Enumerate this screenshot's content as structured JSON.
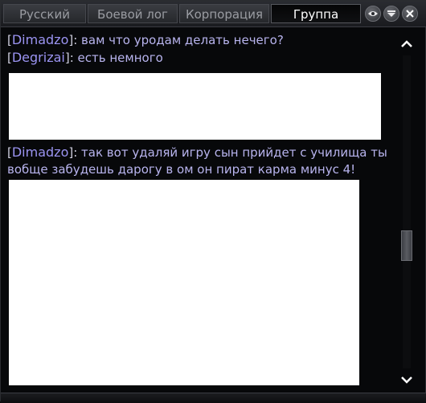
{
  "tabs": [
    {
      "label": "Русский",
      "active": false
    },
    {
      "label": "Боевой лог",
      "active": false
    },
    {
      "label": "Корпорация",
      "active": false
    },
    {
      "label": "Группа",
      "active": true
    }
  ],
  "controls": {
    "visibility_icon": "eye-icon",
    "filter_icon": "filter-icon",
    "close_icon": "close-icon"
  },
  "chat": {
    "messages": [
      {
        "sender": "Dimadzo",
        "text": "вам что уродам делать нечего?"
      },
      {
        "sender": "Degrizai",
        "text": "есть немного"
      },
      {
        "sender": "Dimadzo",
        "text": "так вот удаляй игру сын прийдет с училища ты вобще забудешь дарогу в ом он пират карма минус 4!"
      }
    ]
  },
  "scrollbar": {
    "position_fraction": 0.62
  },
  "colors": {
    "sender": "#9b94f2",
    "message": "#b8b4ee",
    "active_tab_text": "#ffffff"
  }
}
